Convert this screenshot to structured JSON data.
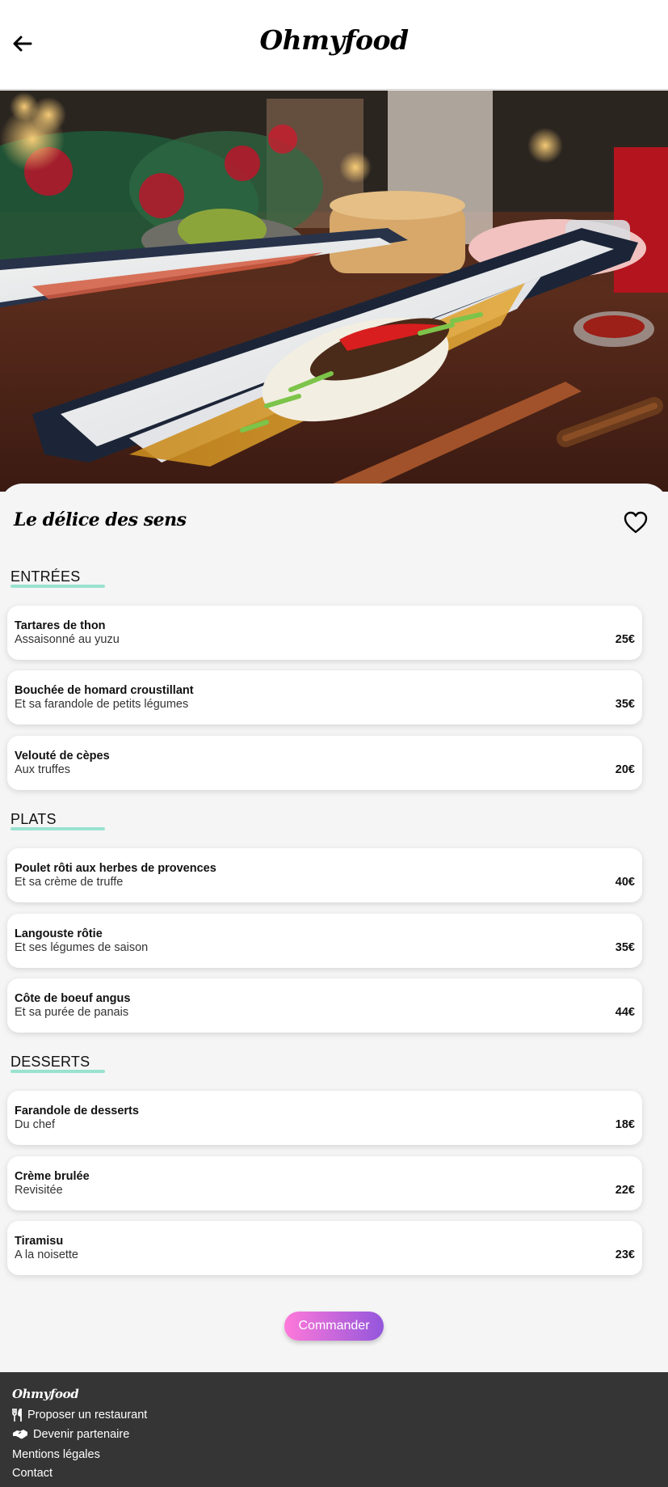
{
  "header": {
    "logo": "Ohmyfood",
    "back_icon": "arrow-left-icon"
  },
  "hero": {
    "image": "plated-fish-dish-photo"
  },
  "restaurant": {
    "name": "Le délice des sens",
    "favorite_icon": "heart-icon"
  },
  "menu": {
    "sections": [
      {
        "title": "ENTRÉES",
        "items": [
          {
            "name": "Tartares de thon",
            "desc": "Assaisonné au yuzu",
            "price": "25€"
          },
          {
            "name": "Bouchée de homard croustillant",
            "desc": "Et sa farandole de petits légumes",
            "price": "35€"
          },
          {
            "name": "Velouté de cèpes",
            "desc": "Aux truffes",
            "price": "20€"
          }
        ]
      },
      {
        "title": "PLATS",
        "items": [
          {
            "name": "Poulet rôti aux herbes de provences",
            "desc": "Et sa crème de truffe",
            "price": "40€"
          },
          {
            "name": "Langouste rôtie",
            "desc": "Et ses légumes de saison",
            "price": "35€"
          },
          {
            "name": "Côte de boeuf angus",
            "desc": "Et sa purée de panais",
            "price": "44€"
          }
        ]
      },
      {
        "title": "DESSERTS",
        "items": [
          {
            "name": "Farandole de desserts",
            "desc": "Du chef",
            "price": "18€"
          },
          {
            "name": "Crème brulée",
            "desc": "Revisitée",
            "price": "22€"
          },
          {
            "name": "Tiramisu",
            "desc": "A la noisette",
            "price": "23€"
          }
        ]
      }
    ]
  },
  "order_button": "Commander",
  "footer": {
    "logo": "Ohmyfood",
    "links": [
      {
        "label": "Proposer un restaurant",
        "icon": "utensils-icon"
      },
      {
        "label": "Devenir partenaire",
        "icon": "handshake-icon"
      },
      {
        "label": "Mentions légales"
      },
      {
        "label": "Contact"
      }
    ]
  },
  "colors": {
    "accent_underline": "#99e2d0",
    "button_from": "#ff79da",
    "button_to": "#9356dc",
    "footer_bg": "#353535"
  }
}
